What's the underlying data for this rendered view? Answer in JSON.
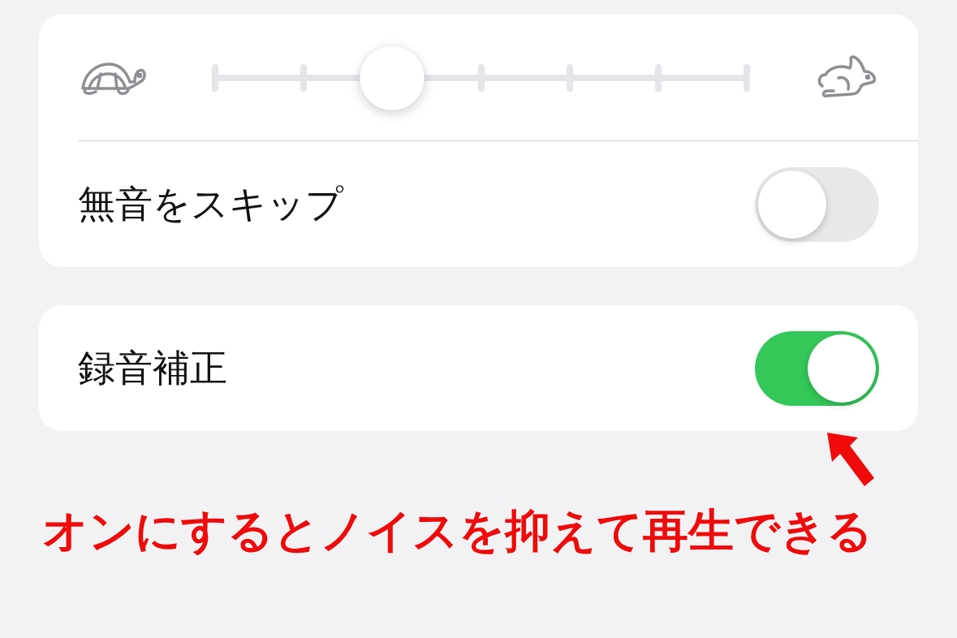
{
  "playback_speed": {
    "level": 0.3333
  },
  "groups": [
    {
      "toggles": [
        {
          "label": "無音をスキップ",
          "on": false
        }
      ]
    },
    {
      "toggles": [
        {
          "label": "録音補正",
          "on": true
        }
      ]
    }
  ],
  "annotation": {
    "text": "オンにするとノイスを抑えて再生できる"
  }
}
